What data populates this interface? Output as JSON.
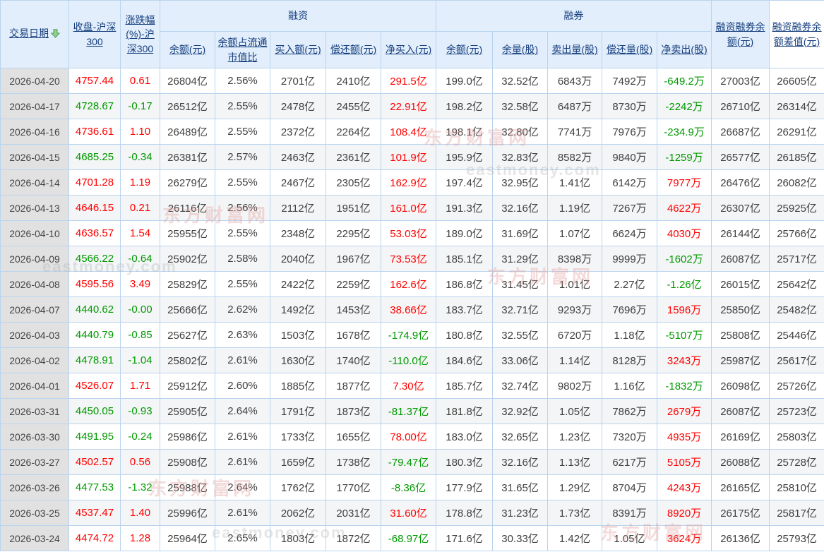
{
  "header": {
    "date_label": "交易日期",
    "close_label": "收盘-沪深300",
    "change_label": "涨跌幅(%)-沪深300",
    "rz_group": "融资",
    "rq_group": "融券",
    "rz_cols": [
      "余额(元)",
      "余额占流通市值比",
      "买入额(元)",
      "偿还额(元)",
      "净买入(元)"
    ],
    "rq_cols": [
      "余额(元)",
      "余量(股)",
      "卖出量(股)",
      "偿还量(股)",
      "净卖出(股)"
    ],
    "total_label": "融资融券余额(元)",
    "diff_label": "融资融券余额差值(元)"
  },
  "colors": {
    "up": "#ff0000",
    "down": "#009900",
    "header_bg": "#e2eefb",
    "grid": "#b9d4ee",
    "date_cell_bg": "#e1e1e1",
    "sort_arrow": "#6abf69"
  },
  "watermark": {
    "cn": "东方财富网",
    "en": "eastmoney.com"
  },
  "rows": [
    {
      "date": "2026-04-20",
      "cells": [
        [
          "4757.44",
          "up"
        ],
        [
          "0.61",
          "up"
        ],
        [
          "26804亿",
          "k"
        ],
        [
          "2.56%",
          "k"
        ],
        [
          "2701亿",
          "k"
        ],
        [
          "2410亿",
          "k"
        ],
        [
          "291.5亿",
          "up"
        ],
        [
          "199.0亿",
          "k"
        ],
        [
          "32.52亿",
          "k"
        ],
        [
          "6843万",
          "k"
        ],
        [
          "7492万",
          "k"
        ],
        [
          "-649.2万",
          "down"
        ],
        [
          "27003亿",
          "k"
        ],
        [
          "26605亿",
          "k"
        ]
      ]
    },
    {
      "date": "2026-04-17",
      "cells": [
        [
          "4728.67",
          "down"
        ],
        [
          "-0.17",
          "down"
        ],
        [
          "26512亿",
          "k"
        ],
        [
          "2.55%",
          "k"
        ],
        [
          "2478亿",
          "k"
        ],
        [
          "2455亿",
          "k"
        ],
        [
          "22.91亿",
          "up"
        ],
        [
          "198.2亿",
          "k"
        ],
        [
          "32.58亿",
          "k"
        ],
        [
          "6487万",
          "k"
        ],
        [
          "8730万",
          "k"
        ],
        [
          "-2242万",
          "down"
        ],
        [
          "26710亿",
          "k"
        ],
        [
          "26314亿",
          "k"
        ]
      ]
    },
    {
      "date": "2026-04-16",
      "cells": [
        [
          "4736.61",
          "up"
        ],
        [
          "1.10",
          "up"
        ],
        [
          "26489亿",
          "k"
        ],
        [
          "2.55%",
          "k"
        ],
        [
          "2372亿",
          "k"
        ],
        [
          "2264亿",
          "k"
        ],
        [
          "108.4亿",
          "up"
        ],
        [
          "198.1亿",
          "k"
        ],
        [
          "32.80亿",
          "k"
        ],
        [
          "7741万",
          "k"
        ],
        [
          "7976万",
          "k"
        ],
        [
          "-234.9万",
          "down"
        ],
        [
          "26687亿",
          "k"
        ],
        [
          "26291亿",
          "k"
        ]
      ]
    },
    {
      "date": "2026-04-15",
      "cells": [
        [
          "4685.25",
          "down"
        ],
        [
          "-0.34",
          "down"
        ],
        [
          "26381亿",
          "k"
        ],
        [
          "2.57%",
          "k"
        ],
        [
          "2463亿",
          "k"
        ],
        [
          "2361亿",
          "k"
        ],
        [
          "101.9亿",
          "up"
        ],
        [
          "195.9亿",
          "k"
        ],
        [
          "32.83亿",
          "k"
        ],
        [
          "8582万",
          "k"
        ],
        [
          "9840万",
          "k"
        ],
        [
          "-1259万",
          "down"
        ],
        [
          "26577亿",
          "k"
        ],
        [
          "26185亿",
          "k"
        ]
      ]
    },
    {
      "date": "2026-04-14",
      "cells": [
        [
          "4701.28",
          "up"
        ],
        [
          "1.19",
          "up"
        ],
        [
          "26279亿",
          "k"
        ],
        [
          "2.55%",
          "k"
        ],
        [
          "2467亿",
          "k"
        ],
        [
          "2305亿",
          "k"
        ],
        [
          "162.9亿",
          "up"
        ],
        [
          "197.4亿",
          "k"
        ],
        [
          "32.95亿",
          "k"
        ],
        [
          "1.41亿",
          "k"
        ],
        [
          "6142万",
          "k"
        ],
        [
          "7977万",
          "up"
        ],
        [
          "26476亿",
          "k"
        ],
        [
          "26082亿",
          "k"
        ]
      ]
    },
    {
      "date": "2026-04-13",
      "cells": [
        [
          "4646.15",
          "up"
        ],
        [
          "0.21",
          "up"
        ],
        [
          "26116亿",
          "k"
        ],
        [
          "2.56%",
          "k"
        ],
        [
          "2112亿",
          "k"
        ],
        [
          "1951亿",
          "k"
        ],
        [
          "161.0亿",
          "up"
        ],
        [
          "191.3亿",
          "k"
        ],
        [
          "32.16亿",
          "k"
        ],
        [
          "1.19亿",
          "k"
        ],
        [
          "7267万",
          "k"
        ],
        [
          "4622万",
          "up"
        ],
        [
          "26307亿",
          "k"
        ],
        [
          "25925亿",
          "k"
        ]
      ]
    },
    {
      "date": "2026-04-10",
      "cells": [
        [
          "4636.57",
          "up"
        ],
        [
          "1.54",
          "up"
        ],
        [
          "25955亿",
          "k"
        ],
        [
          "2.55%",
          "k"
        ],
        [
          "2348亿",
          "k"
        ],
        [
          "2295亿",
          "k"
        ],
        [
          "53.03亿",
          "up"
        ],
        [
          "189.0亿",
          "k"
        ],
        [
          "31.69亿",
          "k"
        ],
        [
          "1.07亿",
          "k"
        ],
        [
          "6624万",
          "k"
        ],
        [
          "4030万",
          "up"
        ],
        [
          "26144亿",
          "k"
        ],
        [
          "25766亿",
          "k"
        ]
      ]
    },
    {
      "date": "2026-04-09",
      "cells": [
        [
          "4566.22",
          "down"
        ],
        [
          "-0.64",
          "down"
        ],
        [
          "25902亿",
          "k"
        ],
        [
          "2.58%",
          "k"
        ],
        [
          "2040亿",
          "k"
        ],
        [
          "1967亿",
          "k"
        ],
        [
          "73.53亿",
          "up"
        ],
        [
          "185.1亿",
          "k"
        ],
        [
          "31.29亿",
          "k"
        ],
        [
          "8398万",
          "k"
        ],
        [
          "9999万",
          "k"
        ],
        [
          "-1602万",
          "down"
        ],
        [
          "26087亿",
          "k"
        ],
        [
          "25717亿",
          "k"
        ]
      ]
    },
    {
      "date": "2026-04-08",
      "cells": [
        [
          "4595.56",
          "up"
        ],
        [
          "3.49",
          "up"
        ],
        [
          "25829亿",
          "k"
        ],
        [
          "2.55%",
          "k"
        ],
        [
          "2422亿",
          "k"
        ],
        [
          "2259亿",
          "k"
        ],
        [
          "162.6亿",
          "up"
        ],
        [
          "186.8亿",
          "k"
        ],
        [
          "31.45亿",
          "k"
        ],
        [
          "1.01亿",
          "k"
        ],
        [
          "2.27亿",
          "k"
        ],
        [
          "-1.26亿",
          "down"
        ],
        [
          "26015亿",
          "k"
        ],
        [
          "25642亿",
          "k"
        ]
      ]
    },
    {
      "date": "2026-04-07",
      "cells": [
        [
          "4440.62",
          "down"
        ],
        [
          "-0.00",
          "down"
        ],
        [
          "25666亿",
          "k"
        ],
        [
          "2.62%",
          "k"
        ],
        [
          "1492亿",
          "k"
        ],
        [
          "1453亿",
          "k"
        ],
        [
          "38.66亿",
          "up"
        ],
        [
          "183.7亿",
          "k"
        ],
        [
          "32.71亿",
          "k"
        ],
        [
          "9293万",
          "k"
        ],
        [
          "7696万",
          "k"
        ],
        [
          "1596万",
          "up"
        ],
        [
          "25850亿",
          "k"
        ],
        [
          "25482亿",
          "k"
        ]
      ]
    },
    {
      "date": "2026-04-03",
      "cells": [
        [
          "4440.79",
          "down"
        ],
        [
          "-0.85",
          "down"
        ],
        [
          "25627亿",
          "k"
        ],
        [
          "2.63%",
          "k"
        ],
        [
          "1503亿",
          "k"
        ],
        [
          "1678亿",
          "k"
        ],
        [
          "-174.9亿",
          "down"
        ],
        [
          "180.8亿",
          "k"
        ],
        [
          "32.55亿",
          "k"
        ],
        [
          "6720万",
          "k"
        ],
        [
          "1.18亿",
          "k"
        ],
        [
          "-5107万",
          "down"
        ],
        [
          "25808亿",
          "k"
        ],
        [
          "25446亿",
          "k"
        ]
      ]
    },
    {
      "date": "2026-04-02",
      "cells": [
        [
          "4478.91",
          "down"
        ],
        [
          "-1.04",
          "down"
        ],
        [
          "25802亿",
          "k"
        ],
        [
          "2.61%",
          "k"
        ],
        [
          "1630亿",
          "k"
        ],
        [
          "1740亿",
          "k"
        ],
        [
          "-110.0亿",
          "down"
        ],
        [
          "184.6亿",
          "k"
        ],
        [
          "33.06亿",
          "k"
        ],
        [
          "1.14亿",
          "k"
        ],
        [
          "8128万",
          "k"
        ],
        [
          "3243万",
          "up"
        ],
        [
          "25987亿",
          "k"
        ],
        [
          "25617亿",
          "k"
        ]
      ]
    },
    {
      "date": "2026-04-01",
      "cells": [
        [
          "4526.07",
          "up"
        ],
        [
          "1.71",
          "up"
        ],
        [
          "25912亿",
          "k"
        ],
        [
          "2.60%",
          "k"
        ],
        [
          "1885亿",
          "k"
        ],
        [
          "1877亿",
          "k"
        ],
        [
          "7.30亿",
          "up"
        ],
        [
          "185.7亿",
          "k"
        ],
        [
          "32.74亿",
          "k"
        ],
        [
          "9802万",
          "k"
        ],
        [
          "1.16亿",
          "k"
        ],
        [
          "-1832万",
          "down"
        ],
        [
          "26098亿",
          "k"
        ],
        [
          "25726亿",
          "k"
        ]
      ]
    },
    {
      "date": "2026-03-31",
      "cells": [
        [
          "4450.05",
          "down"
        ],
        [
          "-0.93",
          "down"
        ],
        [
          "25905亿",
          "k"
        ],
        [
          "2.64%",
          "k"
        ],
        [
          "1791亿",
          "k"
        ],
        [
          "1873亿",
          "k"
        ],
        [
          "-81.37亿",
          "down"
        ],
        [
          "181.8亿",
          "k"
        ],
        [
          "32.92亿",
          "k"
        ],
        [
          "1.05亿",
          "k"
        ],
        [
          "7862万",
          "k"
        ],
        [
          "2679万",
          "up"
        ],
        [
          "26087亿",
          "k"
        ],
        [
          "25723亿",
          "k"
        ]
      ]
    },
    {
      "date": "2026-03-30",
      "cells": [
        [
          "4491.95",
          "down"
        ],
        [
          "-0.24",
          "down"
        ],
        [
          "25986亿",
          "k"
        ],
        [
          "2.61%",
          "k"
        ],
        [
          "1733亿",
          "k"
        ],
        [
          "1655亿",
          "k"
        ],
        [
          "78.00亿",
          "up"
        ],
        [
          "183.0亿",
          "k"
        ],
        [
          "32.65亿",
          "k"
        ],
        [
          "1.23亿",
          "k"
        ],
        [
          "7320万",
          "k"
        ],
        [
          "4935万",
          "up"
        ],
        [
          "26169亿",
          "k"
        ],
        [
          "25803亿",
          "k"
        ]
      ]
    },
    {
      "date": "2026-03-27",
      "cells": [
        [
          "4502.57",
          "up"
        ],
        [
          "0.56",
          "up"
        ],
        [
          "25908亿",
          "k"
        ],
        [
          "2.61%",
          "k"
        ],
        [
          "1659亿",
          "k"
        ],
        [
          "1738亿",
          "k"
        ],
        [
          "-79.47亿",
          "down"
        ],
        [
          "180.3亿",
          "k"
        ],
        [
          "32.16亿",
          "k"
        ],
        [
          "1.13亿",
          "k"
        ],
        [
          "6217万",
          "k"
        ],
        [
          "5105万",
          "up"
        ],
        [
          "26088亿",
          "k"
        ],
        [
          "25728亿",
          "k"
        ]
      ]
    },
    {
      "date": "2026-03-26",
      "cells": [
        [
          "4477.53",
          "down"
        ],
        [
          "-1.32",
          "down"
        ],
        [
          "25988亿",
          "k"
        ],
        [
          "2.64%",
          "k"
        ],
        [
          "1762亿",
          "k"
        ],
        [
          "1770亿",
          "k"
        ],
        [
          "-8.36亿",
          "down"
        ],
        [
          "177.9亿",
          "k"
        ],
        [
          "31.65亿",
          "k"
        ],
        [
          "1.29亿",
          "k"
        ],
        [
          "8704万",
          "k"
        ],
        [
          "4243万",
          "up"
        ],
        [
          "26165亿",
          "k"
        ],
        [
          "25810亿",
          "k"
        ]
      ]
    },
    {
      "date": "2026-03-25",
      "cells": [
        [
          "4537.47",
          "up"
        ],
        [
          "1.40",
          "up"
        ],
        [
          "25996亿",
          "k"
        ],
        [
          "2.61%",
          "k"
        ],
        [
          "2062亿",
          "k"
        ],
        [
          "2031亿",
          "k"
        ],
        [
          "31.60亿",
          "up"
        ],
        [
          "178.8亿",
          "k"
        ],
        [
          "31.23亿",
          "k"
        ],
        [
          "1.73亿",
          "k"
        ],
        [
          "8391万",
          "k"
        ],
        [
          "8920万",
          "up"
        ],
        [
          "26175亿",
          "k"
        ],
        [
          "25817亿",
          "k"
        ]
      ]
    },
    {
      "date": "2026-03-24",
      "cells": [
        [
          "4474.72",
          "up"
        ],
        [
          "1.28",
          "up"
        ],
        [
          "25964亿",
          "k"
        ],
        [
          "2.65%",
          "k"
        ],
        [
          "1803亿",
          "k"
        ],
        [
          "1872亿",
          "k"
        ],
        [
          "-68.97亿",
          "down"
        ],
        [
          "171.6亿",
          "k"
        ],
        [
          "30.33亿",
          "k"
        ],
        [
          "1.42亿",
          "k"
        ],
        [
          "1.05亿",
          "k"
        ],
        [
          "3624万",
          "up"
        ],
        [
          "26136亿",
          "k"
        ],
        [
          "25793亿",
          "k"
        ]
      ]
    }
  ]
}
